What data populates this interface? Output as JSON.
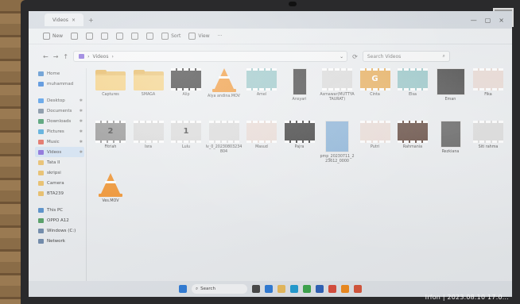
{
  "window": {
    "tab_title": "Videos",
    "close_glyph": "×",
    "add_glyph": "+",
    "minimize_glyph": "—",
    "maximize_glyph": "▢"
  },
  "toolbar": {
    "new_label": "New",
    "sort_label": "Sort",
    "view_label": "View",
    "more_label": "···"
  },
  "address": {
    "back_glyph": "←",
    "forward_glyph": "→",
    "up_glyph": "↑",
    "path_separator": "›",
    "path": "Videos",
    "chevron_glyph": "⌄",
    "refresh_glyph": "⟳",
    "search_placeholder": "Search Videos"
  },
  "nav": {
    "items": [
      {
        "label": "Home",
        "color": "#3f83c9"
      },
      {
        "label": "muhammad",
        "color": "#2b79d6"
      },
      {
        "label": "Desktop",
        "color": "#3a8ee6"
      },
      {
        "label": "Documents",
        "color": "#6b7f94"
      },
      {
        "label": "Downloads",
        "color": "#2f8f5a"
      },
      {
        "label": "Pictures",
        "color": "#3aa0d8"
      },
      {
        "label": "Music",
        "color": "#e05a4b"
      },
      {
        "label": "Videos",
        "color": "#7a5bd6"
      },
      {
        "label": "Tata II",
        "color": "#e8b95a"
      },
      {
        "label": "skripsi",
        "color": "#e8b95a"
      },
      {
        "label": "Camera",
        "color": "#e8b95a"
      },
      {
        "label": "BTA239",
        "color": "#e8b95a"
      },
      {
        "label": "This PC",
        "color": "#4a88c7"
      },
      {
        "label": "OPPO A12",
        "color": "#4a9a5c"
      },
      {
        "label": "Windows (C:)",
        "color": "#6a86a8"
      },
      {
        "label": "Network",
        "color": "#6a86a8"
      }
    ],
    "pin_glyph": "✱"
  },
  "files": [
    {
      "name": "Captures",
      "kind": "folder"
    },
    {
      "name": "SMAGA",
      "kind": "folder"
    },
    {
      "name": "Alip",
      "kind": "video-dark"
    },
    {
      "name": "Alya andina.MOV",
      "kind": "vlc"
    },
    {
      "name": "Amel",
      "kind": "video-teal"
    },
    {
      "name": "Ansyari",
      "kind": "portrait"
    },
    {
      "name": "Asmawar(MUTTYA TAURAT)",
      "kind": "video-light"
    },
    {
      "name": "Cinta",
      "kind": "video-orange",
      "glyph": "G"
    },
    {
      "name": "Elsa",
      "kind": "video-teal"
    },
    {
      "name": "Eman",
      "kind": "square-dark"
    },
    {
      "name": "Fika",
      "kind": "video-pink"
    },
    {
      "name": "Fitriah",
      "kind": "video-gray",
      "glyph": "2"
    },
    {
      "name": "Isra",
      "kind": "video-light"
    },
    {
      "name": "Lulu",
      "kind": "video-light",
      "glyph": "1"
    },
    {
      "name": "lv_0_20230803234804",
      "kind": "video-light"
    },
    {
      "name": "Masud",
      "kind": "video-pink"
    },
    {
      "name": "Pajra",
      "kind": "video-dark"
    },
    {
      "name": "pmp_20230711_223612_0000",
      "kind": "portrait-blue"
    },
    {
      "name": "Putri",
      "kind": "video-pink"
    },
    {
      "name": "Rahmania",
      "kind": "video-brown"
    },
    {
      "name": "Rezkiana",
      "kind": "portrait-gray"
    },
    {
      "name": "Siti rahma",
      "kind": "video-light"
    },
    {
      "name": "Ves.MOV",
      "kind": "vlc"
    }
  ],
  "taskbar": {
    "search_label": "Search",
    "search_glyph": "⌕",
    "apps": [
      {
        "name": "task-view",
        "color": "#444444"
      },
      {
        "name": "widgets",
        "color": "#2b79d6"
      },
      {
        "name": "file-explorer",
        "color": "#e8b95a"
      },
      {
        "name": "edge",
        "color": "#1f9bd1"
      },
      {
        "name": "chrome",
        "color": "#3aa54a"
      },
      {
        "name": "word",
        "color": "#2b5fb8"
      },
      {
        "name": "wps",
        "color": "#d94b3b"
      },
      {
        "name": "vlc",
        "color": "#f08a1c"
      },
      {
        "name": "store",
        "color": "#d6543a"
      }
    ]
  },
  "photo_stamp": "Irfon | 2023.08.10 17:0..."
}
